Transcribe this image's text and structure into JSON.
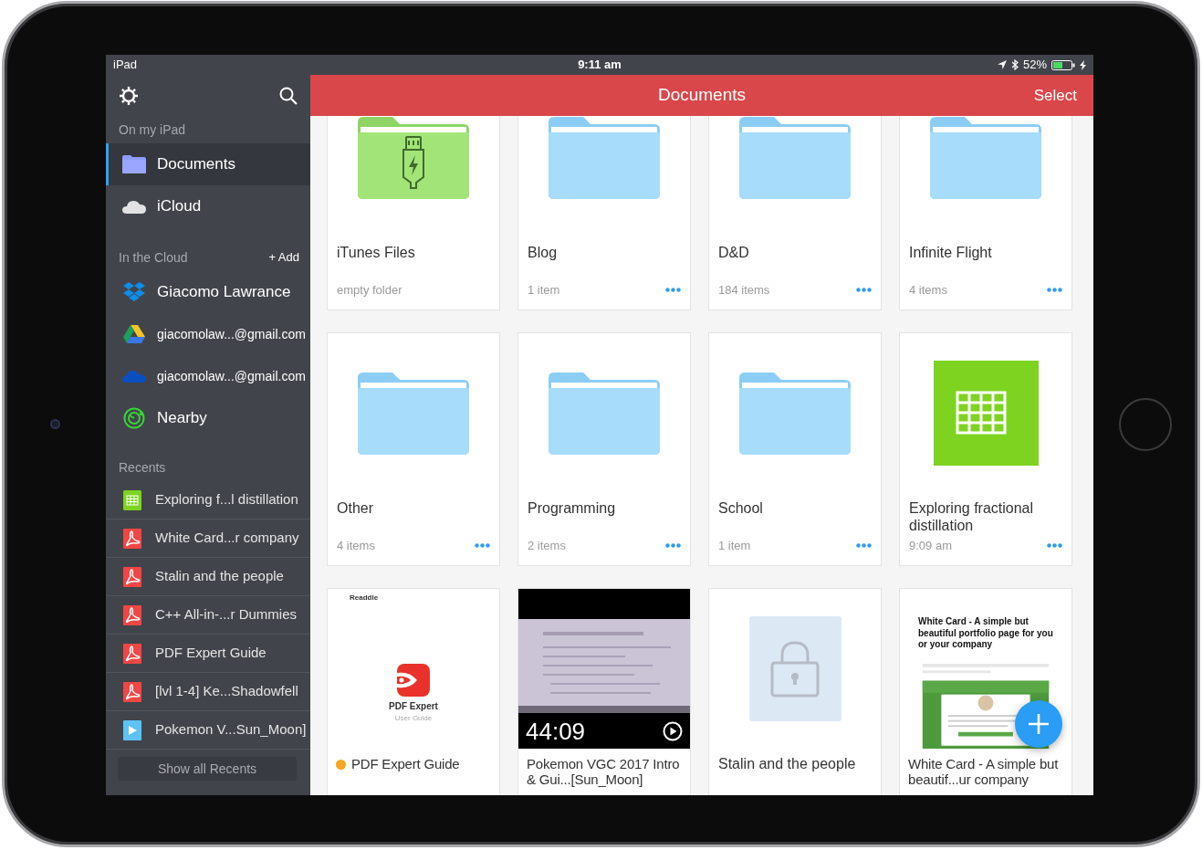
{
  "status_bar": {
    "device": "iPad",
    "time": "9:11 am",
    "battery": "52%"
  },
  "sidebar": {
    "sections": [
      {
        "title": "On my iPad",
        "items": [
          {
            "label": "Documents",
            "kind": "folder",
            "selected": true
          },
          {
            "label": "iCloud",
            "kind": "icloud",
            "selected": false
          }
        ]
      },
      {
        "title": "In the Cloud",
        "action": "+ Add",
        "items": [
          {
            "label": "Giacomo Lawrance",
            "kind": "dropbox",
            "selected": false
          },
          {
            "label": "giacomolaw...@gmail.com",
            "kind": "gdrive",
            "selected": false
          },
          {
            "label": "giacomolaw...@gmail.com",
            "kind": "onedrive",
            "selected": false
          },
          {
            "label": "Nearby",
            "kind": "nearby",
            "selected": false
          }
        ]
      }
    ],
    "recents": {
      "title": "Recents",
      "button": "Show all Recents",
      "items": [
        {
          "label": "Exploring f...l distillation",
          "kind": "sheet"
        },
        {
          "label": "White Card...r company",
          "kind": "pdf"
        },
        {
          "label": "Stalin and the people",
          "kind": "pdf"
        },
        {
          "label": "C++ All-in-...r Dummies",
          "kind": "pdf"
        },
        {
          "label": "PDF Expert Guide",
          "kind": "pdf"
        },
        {
          "label": "[lvl 1-4] Ke...Shadowfell",
          "kind": "pdf"
        },
        {
          "label": "Pokemon V...Sun_Moon]",
          "kind": "video"
        }
      ]
    }
  },
  "header": {
    "title": "Documents",
    "action": "Select"
  },
  "cards": [
    {
      "kind": "itunes",
      "title": "iTunes Files",
      "subtitle": "empty folder",
      "menu": false
    },
    {
      "kind": "folder",
      "title": "Blog",
      "subtitle": "1 item",
      "menu": true
    },
    {
      "kind": "folder",
      "title": "D&D",
      "subtitle": "184 items",
      "menu": true
    },
    {
      "kind": "folder",
      "title": "Infinite Flight",
      "subtitle": "4 items",
      "menu": true
    },
    {
      "kind": "folder",
      "title": "Other",
      "subtitle": "4 items",
      "menu": true
    },
    {
      "kind": "folder",
      "title": "Programming",
      "subtitle": "2 items",
      "menu": true
    },
    {
      "kind": "folder",
      "title": "School",
      "subtitle": "1 item",
      "menu": true
    },
    {
      "kind": "sheet",
      "title": "Exploring fractional distillation",
      "subtitle": "9:09 am",
      "menu": true
    },
    {
      "kind": "pdf",
      "title": "PDF Expert Guide",
      "color": "#f5a623",
      "thumb": {
        "publisher": "Readdle",
        "name": "PDF Expert",
        "note": "User Guide"
      }
    },
    {
      "kind": "video",
      "title": "Pokemon VGC 2017 Intro & Gui...[Sun_Moon]",
      "thumb": {
        "duration": "44:09"
      }
    },
    {
      "kind": "locked",
      "title": "Stalin and the people"
    },
    {
      "kind": "document",
      "title": "White Card - A simple but beautif...ur company",
      "thumb": {
        "heading": "White Card - A simple but beautiful portfolio page for you or your company"
      }
    }
  ]
}
